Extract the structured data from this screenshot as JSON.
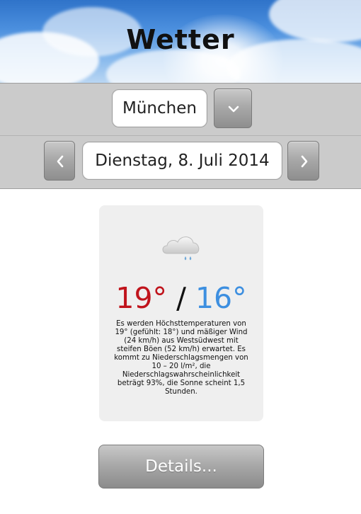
{
  "header": {
    "title": "Wetter"
  },
  "location": {
    "city": "München",
    "dropdown_icon": "chevron-down-icon"
  },
  "date_nav": {
    "date": "Dienstag, 8. Juli 2014",
    "prev_icon": "chevron-left-icon",
    "next_icon": "chevron-right-icon"
  },
  "forecast": {
    "icon": "cloud-rain-icon",
    "high": "19°",
    "separator": "/",
    "low": "16°",
    "description": "Es werden Höchsttemperaturen von 19° (gefühlt: 18°) und mäßiger Wind (24 km/h) aus Westsüdwest mit steifen Böen (52 km/h) erwartet. Es kommt zu Niederschlagsmengen von 10 – 20 l/m², die Niederschlagswahrscheinlichkeit beträgt 93%, die Sonne scheint 1,5 Stunden.",
    "colors": {
      "high": "#c0141c",
      "low": "#3d8fe0"
    }
  },
  "actions": {
    "details_label": "Details..."
  }
}
